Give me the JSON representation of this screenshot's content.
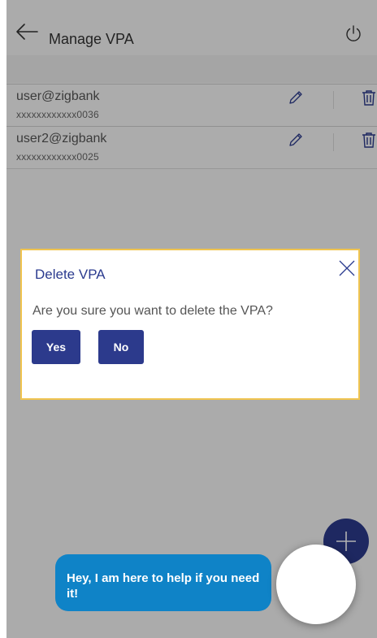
{
  "header": {
    "title": "Manage VPA"
  },
  "vpas": [
    {
      "vpa": "user@zigbank",
      "account": "xxxxxxxxxxxx0036"
    },
    {
      "vpa": "user2@zigbank",
      "account": "xxxxxxxxxxxx0025"
    }
  ],
  "modal": {
    "title": "Delete VPA",
    "message": "Are you sure you want to delete the VPA?",
    "yes_label": "Yes",
    "no_label": "No"
  },
  "chat": {
    "message": "Hey, I am here to help if you need it!"
  },
  "icons": {
    "back": "arrow-left-icon",
    "power": "power-icon",
    "edit": "pencil-icon",
    "delete": "trash-icon",
    "close": "close-icon",
    "add": "plus-icon"
  },
  "colors": {
    "primary": "#2c3a8c",
    "modal_border": "#f0c44f",
    "modal_title": "#2b3b8f",
    "chat_bubble": "#0f83c7"
  }
}
